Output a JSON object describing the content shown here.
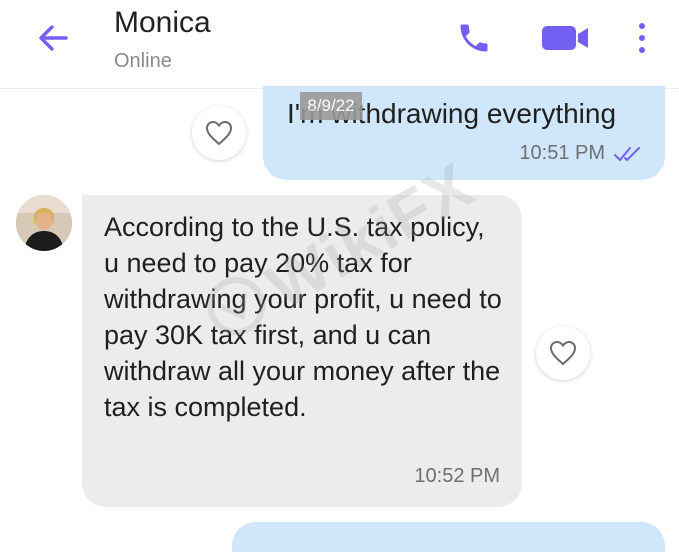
{
  "header": {
    "contact_name": "Monica",
    "status": "Online"
  },
  "date_chip": "8/9/22",
  "messages": [
    {
      "direction": "outgoing",
      "text": "I'm withdrawing everything",
      "time": "10:51 PM",
      "read": true
    },
    {
      "direction": "incoming",
      "text": "According to the U.S. tax policy, u need to pay 20% tax for withdrawing your profit, u need to pay 30K tax first, and u can withdraw all your money after the tax is completed.",
      "time": "10:52 PM"
    }
  ],
  "watermark": "WikiFX",
  "colors": {
    "accent": "#7360f2",
    "outgoing_bubble": "#cfe6fb",
    "incoming_bubble": "#ececec"
  }
}
